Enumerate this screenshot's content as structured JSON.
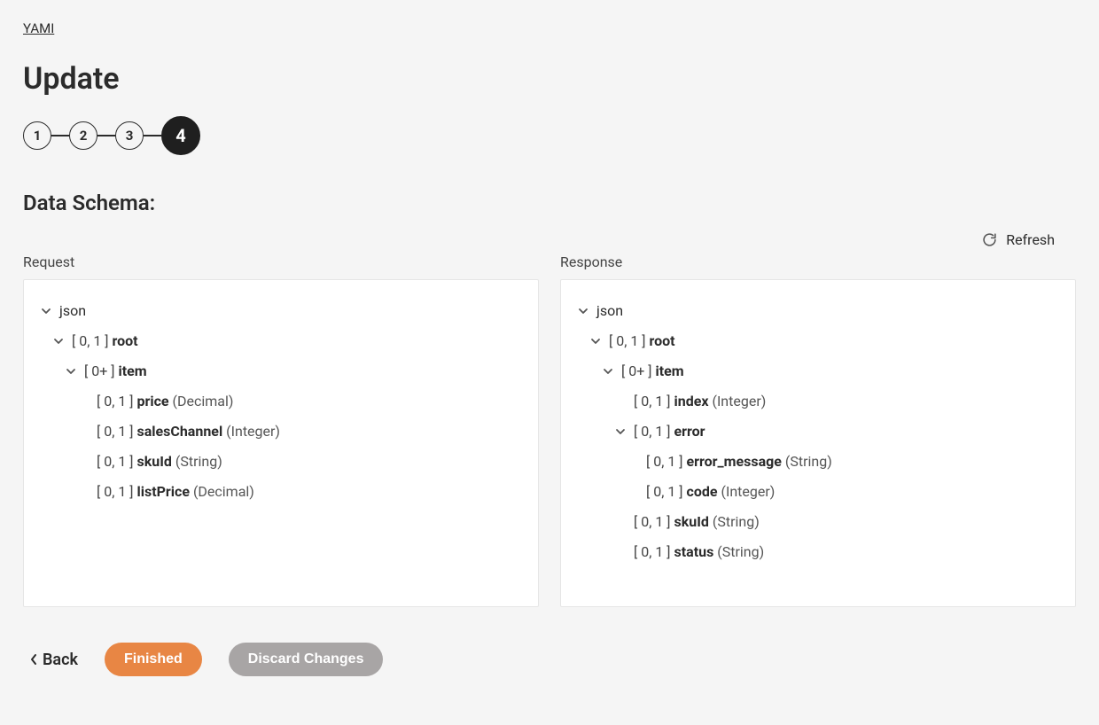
{
  "breadcrumb": {
    "root": "YAMI"
  },
  "title": "Update",
  "steps": [
    "1",
    "2",
    "3",
    "4"
  ],
  "active_step_index": 3,
  "section_title": "Data Schema:",
  "refresh_label": "Refresh",
  "panels": {
    "request": {
      "label": "Request",
      "tree": [
        {
          "depth": 0,
          "expandable": true,
          "text": "json"
        },
        {
          "depth": 1,
          "expandable": true,
          "card": "[ 0, 1 ]",
          "name": "root"
        },
        {
          "depth": 2,
          "expandable": true,
          "card": "[ 0+ ]",
          "name": "item"
        },
        {
          "depth": 3,
          "expandable": false,
          "card": "[ 0, 1 ]",
          "name": "price",
          "type": "(Decimal)"
        },
        {
          "depth": 3,
          "expandable": false,
          "card": "[ 0, 1 ]",
          "name": "salesChannel",
          "type": "(Integer)"
        },
        {
          "depth": 3,
          "expandable": false,
          "card": "[ 0, 1 ]",
          "name": "skuId",
          "type": "(String)"
        },
        {
          "depth": 3,
          "expandable": false,
          "card": "[ 0, 1 ]",
          "name": "listPrice",
          "type": "(Decimal)"
        }
      ]
    },
    "response": {
      "label": "Response",
      "tree": [
        {
          "depth": 0,
          "expandable": true,
          "text": "json"
        },
        {
          "depth": 1,
          "expandable": true,
          "card": "[ 0, 1 ]",
          "name": "root"
        },
        {
          "depth": 2,
          "expandable": true,
          "card": "[ 0+ ]",
          "name": "item"
        },
        {
          "depth": 3,
          "expandable": false,
          "card": "[ 0, 1 ]",
          "name": "index",
          "type": "(Integer)"
        },
        {
          "depth": 3,
          "expandable": true,
          "card": "[ 0, 1 ]",
          "name": "error"
        },
        {
          "depth": 4,
          "expandable": false,
          "card": "[ 0, 1 ]",
          "name": "error_message",
          "type": "(String)"
        },
        {
          "depth": 4,
          "expandable": false,
          "card": "[ 0, 1 ]",
          "name": "code",
          "type": "(Integer)"
        },
        {
          "depth": 3,
          "expandable": false,
          "card": "[ 0, 1 ]",
          "name": "skuId",
          "type": "(String)"
        },
        {
          "depth": 3,
          "expandable": false,
          "card": "[ 0, 1 ]",
          "name": "status",
          "type": "(String)"
        }
      ]
    }
  },
  "footer": {
    "back": "Back",
    "finished": "Finished",
    "discard": "Discard Changes"
  }
}
